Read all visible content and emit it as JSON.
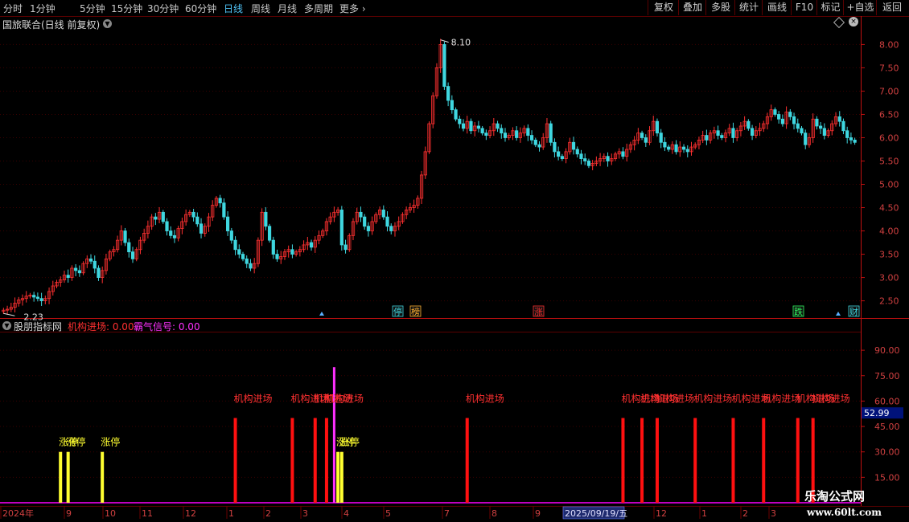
{
  "toolbar": {
    "periods": [
      "分时",
      "1分钟",
      "5分钟",
      "15分钟",
      "30分钟",
      "60分钟",
      "日线",
      "周线",
      "月线",
      "多周期",
      "更多"
    ],
    "active_period": "日线",
    "right_buttons": [
      "复权",
      "叠加",
      "多股",
      "统计",
      "画线",
      "F10",
      "标记",
      "+自选",
      "返回"
    ]
  },
  "stock": {
    "title": "国旅联合(日线 前复权)"
  },
  "indicator": {
    "name": "股朋指标网",
    "line1": "机构进场: 0.00",
    "line2": "霸气信号: 0.00",
    "current_value": "52.99"
  },
  "colors": {
    "up": "#ff3030",
    "down": "#3fd7e0",
    "axis": "#c01010",
    "signal_red": "#ff1010",
    "signal_yellow": "#ffff30",
    "signal_magenta": "#ff30ff",
    "baseline": "#c000c0",
    "date_highlight": "#1e2a6e"
  },
  "chart_data": [
    {
      "type": "candlestick",
      "title": "国旅联合(日线 前复权)",
      "y_ticks": [
        "2.50",
        "3.00",
        "3.50",
        "4.00",
        "4.50",
        "5.00",
        "5.50",
        "6.00",
        "6.50",
        "7.00",
        "7.50",
        "8.00"
      ],
      "ylim": [
        2.2,
        8.3
      ],
      "annotations": {
        "high": "8.10",
        "low": "2.23"
      },
      "markers": [
        "停",
        "榜",
        "涨",
        "跌",
        "财"
      ],
      "closes": [
        2.3,
        2.32,
        2.36,
        2.45,
        2.52,
        2.55,
        2.6,
        2.62,
        2.58,
        2.55,
        2.5,
        2.55,
        2.7,
        2.82,
        2.9,
        2.95,
        3.05,
        3.0,
        3.2,
        3.15,
        3.1,
        3.3,
        3.4,
        3.35,
        3.2,
        3.0,
        3.15,
        3.4,
        3.55,
        3.6,
        3.8,
        4.0,
        3.75,
        3.55,
        3.4,
        3.6,
        3.8,
        3.95,
        4.1,
        4.3,
        4.25,
        4.4,
        4.2,
        4.0,
        3.9,
        3.85,
        4.05,
        4.2,
        4.35,
        4.4,
        4.3,
        4.15,
        3.95,
        4.1,
        4.3,
        4.55,
        4.7,
        4.6,
        4.3,
        4.0,
        3.8,
        3.6,
        3.5,
        3.4,
        3.3,
        3.2,
        3.3,
        3.8,
        4.4,
        4.1,
        3.8,
        3.5,
        3.4,
        3.45,
        3.55,
        3.6,
        3.5,
        3.55,
        3.6,
        3.7,
        3.75,
        3.65,
        3.8,
        3.9,
        4.0,
        4.2,
        4.3,
        4.4,
        4.45,
        3.7,
        3.6,
        3.9,
        4.2,
        4.4,
        4.3,
        4.1,
        4.0,
        4.2,
        4.35,
        4.45,
        4.3,
        4.1,
        4.0,
        4.1,
        4.2,
        4.35,
        4.45,
        4.5,
        4.55,
        4.7,
        5.2,
        5.7,
        6.3,
        6.9,
        7.5,
        8.0,
        7.1,
        6.8,
        6.6,
        6.4,
        6.3,
        6.2,
        6.35,
        6.15,
        6.25,
        6.2,
        6.1,
        6.05,
        6.15,
        6.3,
        6.2,
        6.1,
        6.0,
        6.05,
        6.15,
        6.0,
        6.1,
        6.2,
        6.05,
        5.95,
        5.85,
        5.8,
        6.0,
        6.3,
        5.9,
        5.7,
        5.6,
        5.55,
        5.7,
        5.9,
        5.75,
        5.65,
        5.55,
        5.5,
        5.4,
        5.45,
        5.5,
        5.55,
        5.6,
        5.5,
        5.55,
        5.65,
        5.7,
        5.6,
        5.75,
        5.85,
        5.95,
        6.1,
        6.0,
        5.9,
        6.15,
        6.35,
        6.1,
        5.9,
        5.8,
        5.75,
        5.85,
        5.7,
        5.8,
        5.75,
        5.7,
        5.8,
        5.85,
        5.95,
        6.05,
        5.95,
        6.1,
        6.15,
        6.05,
        6.0,
        6.1,
        6.2,
        6.0,
        6.15,
        6.25,
        6.35,
        6.2,
        6.05,
        6.15,
        6.2,
        6.3,
        6.45,
        6.6,
        6.5,
        6.4,
        6.3,
        6.55,
        6.45,
        6.3,
        6.2,
        6.1,
        5.85,
        6.0,
        6.4,
        6.25,
        6.2,
        6.05,
        6.15,
        6.3,
        6.45,
        6.35,
        6.15,
        6.0,
        5.95,
        5.9
      ]
    },
    {
      "type": "bar",
      "title": "股朋指标网",
      "y_ticks": [
        "15.00",
        "30.00",
        "45.00",
        "60.00",
        "75.00",
        "90.00"
      ],
      "ylim": [
        0,
        100
      ],
      "x_labels": [
        "2024年",
        "9",
        "10",
        "11",
        "12",
        "1",
        "2",
        "3",
        "4",
        "5",
        "7",
        "8",
        "9",
        "2025/09/19/五",
        "12",
        "1",
        "2",
        "3"
      ],
      "signal_labels": {
        "red": "机构进场",
        "yellow": "涨停"
      },
      "red_bars": [
        {
          "i": 61,
          "v": 50
        },
        {
          "i": 76,
          "v": 50
        },
        {
          "i": 82,
          "v": 50
        },
        {
          "i": 85,
          "v": 50
        },
        {
          "i": 122,
          "v": 50
        },
        {
          "i": 163,
          "v": 50
        },
        {
          "i": 168,
          "v": 50
        },
        {
          "i": 172,
          "v": 50
        },
        {
          "i": 182,
          "v": 50
        },
        {
          "i": 192,
          "v": 50
        },
        {
          "i": 200,
          "v": 50
        },
        {
          "i": 209,
          "v": 50
        },
        {
          "i": 213,
          "v": 50
        },
        {
          "i": 241,
          "v": 50
        },
        {
          "i": 247,
          "v": 50
        },
        {
          "i": 302,
          "v": 50
        },
        {
          "i": 319,
          "v": 50
        }
      ],
      "yellow_bars": [
        {
          "i": 15,
          "v": 30
        },
        {
          "i": 17,
          "v": 30
        },
        {
          "i": 26,
          "v": 30
        },
        {
          "i": 88,
          "v": 30
        },
        {
          "i": 89,
          "v": 30
        }
      ],
      "magenta_bars": [
        {
          "i": 87,
          "v": 80
        }
      ]
    }
  ]
}
